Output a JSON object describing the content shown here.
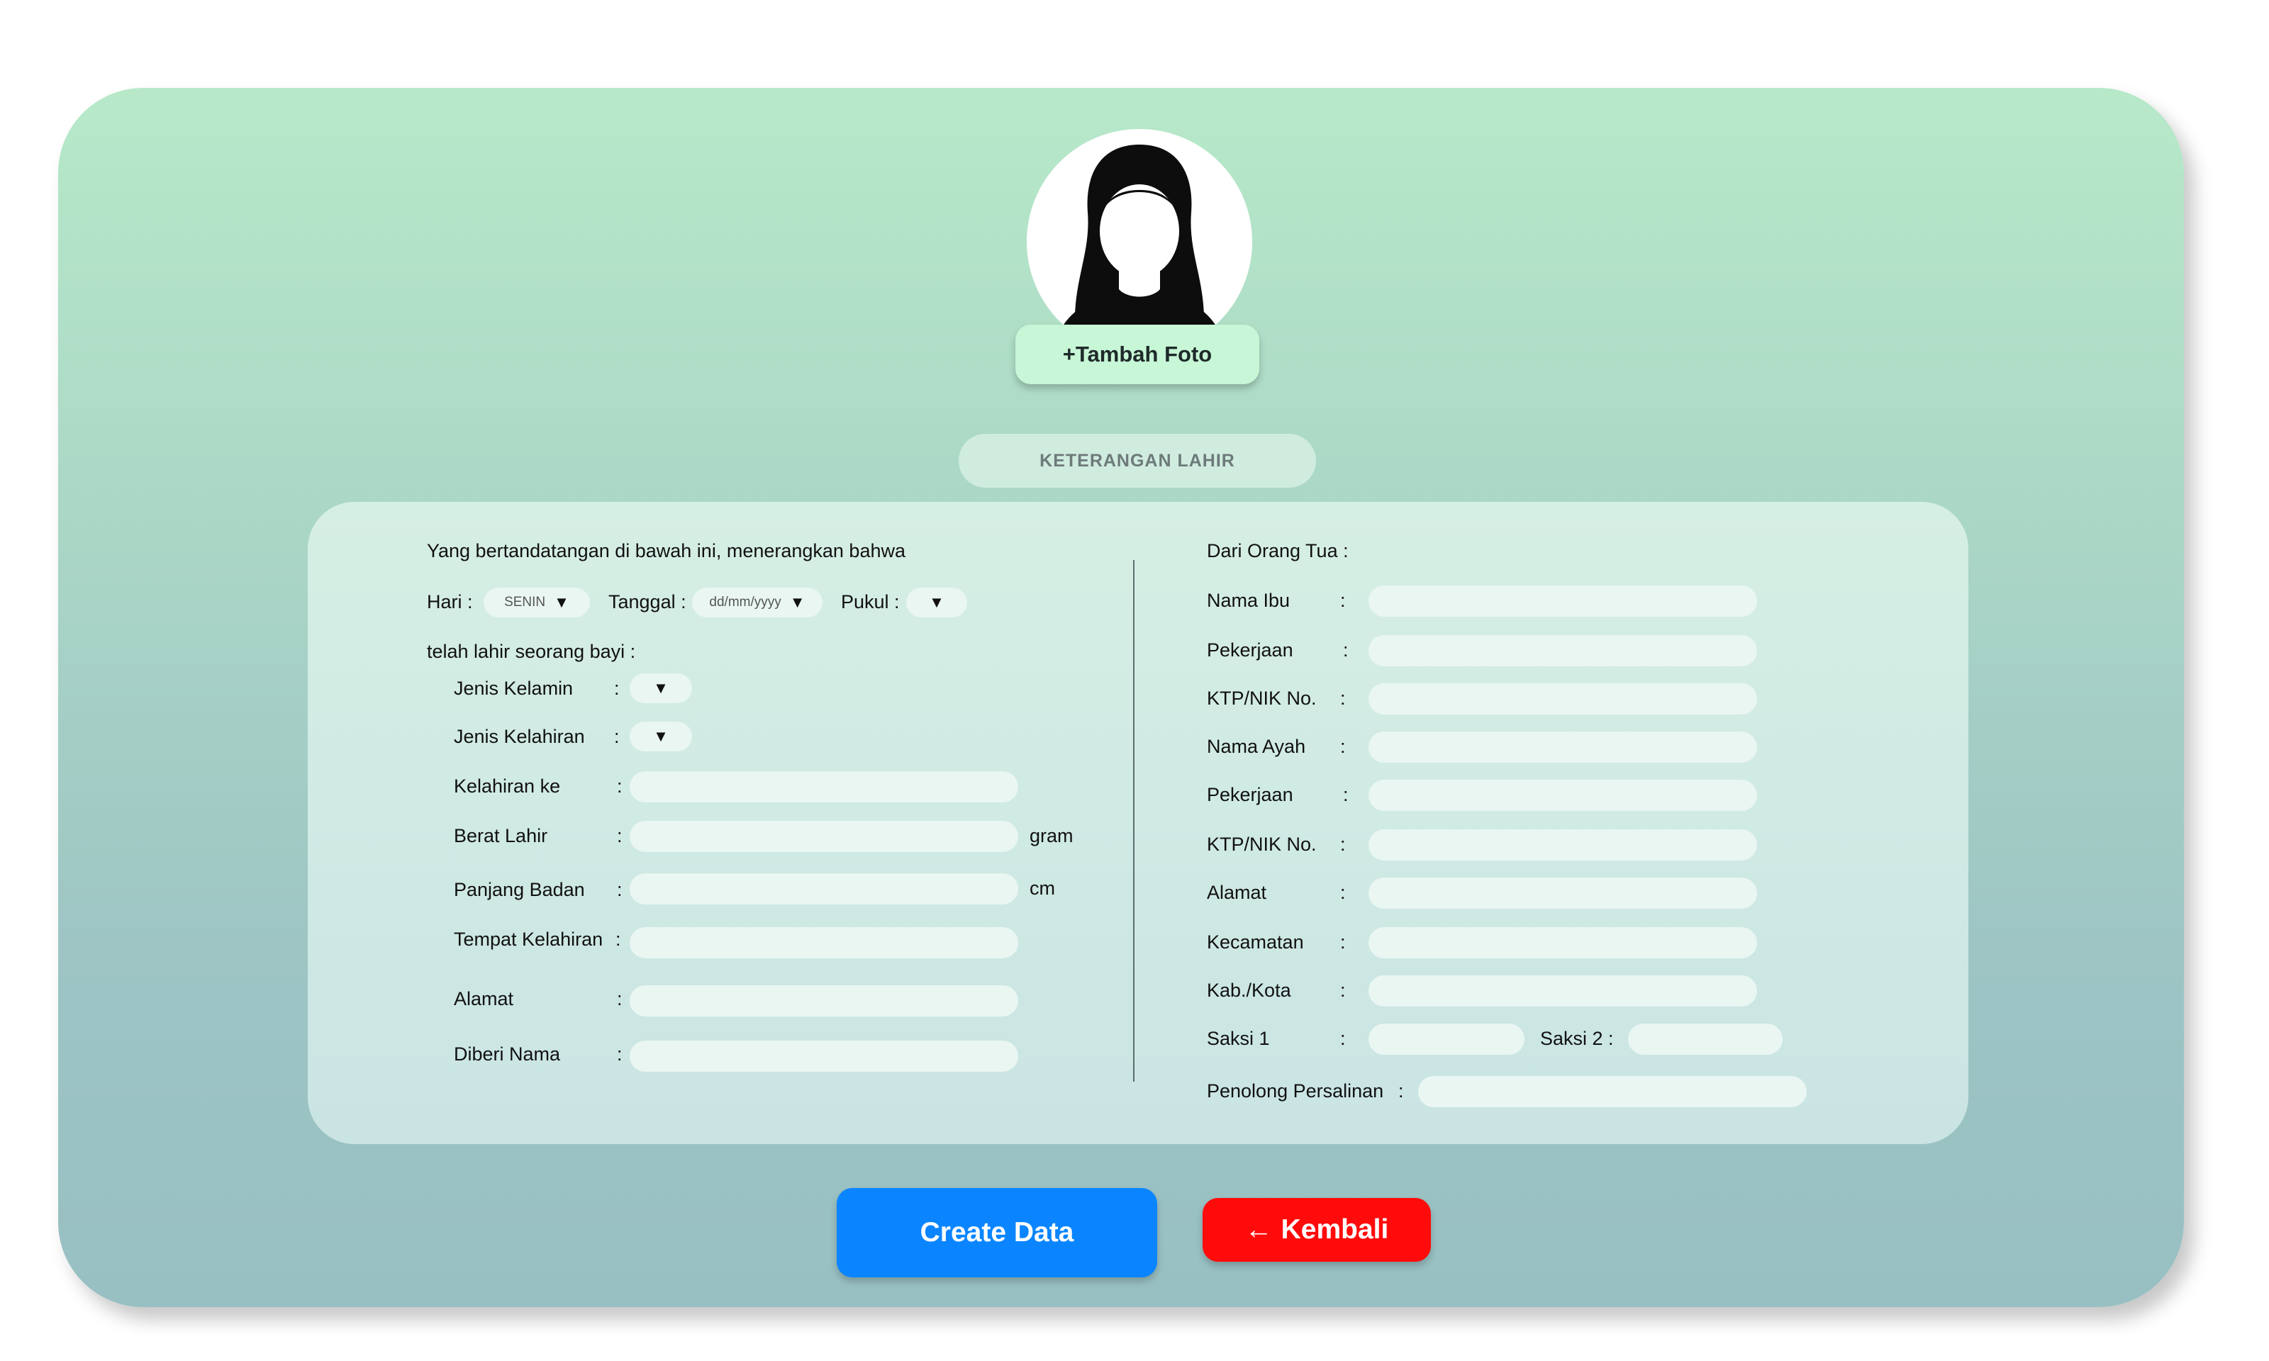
{
  "photo": {
    "add_label": "+Tambah Foto"
  },
  "section": {
    "title": "KETERANGAN LAHIR"
  },
  "left": {
    "intro": "Yang bertandatangan di bawah ini, menerangkan bahwa",
    "hari_label": "Hari :",
    "hari_value": "SENIN",
    "tanggal_label": "Tanggal :",
    "tanggal_placeholder": "dd/mm/yyyy",
    "pukul_label": "Pukul :",
    "born_text": "telah lahir seorang bayi :",
    "fields": {
      "jenis_kelamin": "Jenis Kelamin",
      "jenis_kelahiran": "Jenis Kelahiran",
      "kelahiran_ke": "Kelahiran ke",
      "berat_lahir": "Berat Lahir",
      "panjang_badan": "Panjang Badan",
      "tempat_kelahiran": "Tempat Kelahiran",
      "alamat": "Alamat",
      "diberi_nama": "Diberi Nama"
    },
    "units": {
      "gram": "gram",
      "cm": "cm"
    },
    "colon": ":"
  },
  "right": {
    "heading": "Dari Orang Tua :",
    "fields": {
      "nama_ibu": "Nama Ibu",
      "pekerjaan_ibu": "Pekerjaan",
      "ktp_ibu": "KTP/NIK No.",
      "nama_ayah": "Nama Ayah",
      "pekerjaan_ayah": "Pekerjaan",
      "ktp_ayah": "KTP/NIK No.",
      "alamat": "Alamat",
      "kecamatan": "Kecamatan",
      "kabkota": "Kab./Kota",
      "saksi1": "Saksi 1",
      "saksi2": "Saksi 2 :",
      "penolong": "Penolong Persalinan"
    },
    "colon": ":"
  },
  "actions": {
    "create": "Create Data",
    "back": "Kembali",
    "back_icon": "←"
  },
  "colors": {
    "create": "#0a85ff",
    "back": "#ff0b0b",
    "photo_button": "#c7f7d6"
  },
  "icons": {
    "avatar": "female-avatar-icon",
    "dropdown": "caret-down-icon",
    "back": "arrow-left-icon"
  }
}
